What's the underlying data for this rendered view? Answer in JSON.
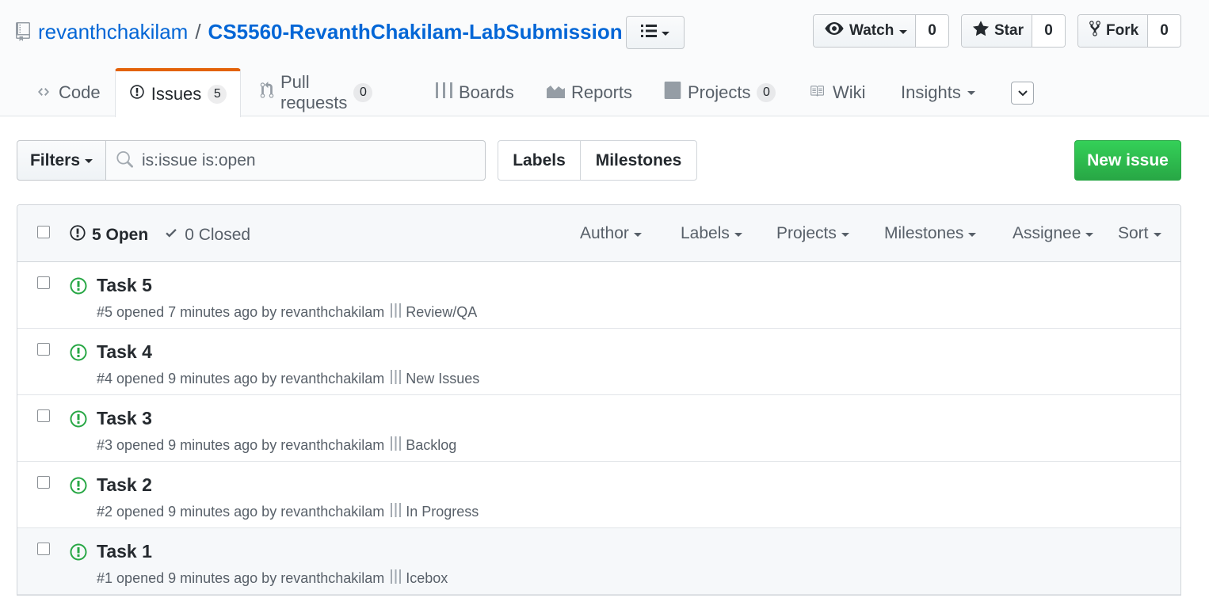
{
  "repo": {
    "owner": "revanthchakilam",
    "separator": "/",
    "name": "CS5560-RevanthChakilam-LabSubmission"
  },
  "social": {
    "watch_label": "Watch",
    "watch_count": "0",
    "star_label": "Star",
    "star_count": "0",
    "fork_label": "Fork",
    "fork_count": "0"
  },
  "tabs": {
    "code": "Code",
    "issues": "Issues",
    "issues_count": "5",
    "pulls": "Pull requests",
    "pulls_count": "0",
    "boards": "Boards",
    "reports": "Reports",
    "projects": "Projects",
    "projects_count": "0",
    "wiki": "Wiki",
    "insights": "Insights"
  },
  "subnav": {
    "filters_label": "Filters",
    "search_value": "is:issue is:open",
    "labels_label": "Labels",
    "milestones_label": "Milestones",
    "new_issue_label": "New issue"
  },
  "list_header": {
    "open_label": "5 Open",
    "closed_label": "0 Closed",
    "author": "Author",
    "labels": "Labels",
    "projects": "Projects",
    "milestones": "Milestones",
    "assignee": "Assignee",
    "sort": "Sort"
  },
  "issues": [
    {
      "title": "Task 5",
      "number": "#5",
      "opened": "opened 7 minutes ago by",
      "author": "revanthchakilam",
      "project": "Review/QA"
    },
    {
      "title": "Task 4",
      "number": "#4",
      "opened": "opened 9 minutes ago by",
      "author": "revanthchakilam",
      "project": "New Issues"
    },
    {
      "title": "Task 3",
      "number": "#3",
      "opened": "opened 9 minutes ago by",
      "author": "revanthchakilam",
      "project": "Backlog"
    },
    {
      "title": "Task 2",
      "number": "#2",
      "opened": "opened 9 minutes ago by",
      "author": "revanthchakilam",
      "project": "In Progress"
    },
    {
      "title": "Task 1",
      "number": "#1",
      "opened": "opened 9 minutes ago by",
      "author": "revanthchakilam",
      "project": "Icebox"
    }
  ],
  "colors": {
    "link": "#0366d6",
    "open_icon": "#28a745",
    "tab_accent": "#e36209",
    "new_issue_bg": "#28a745"
  }
}
